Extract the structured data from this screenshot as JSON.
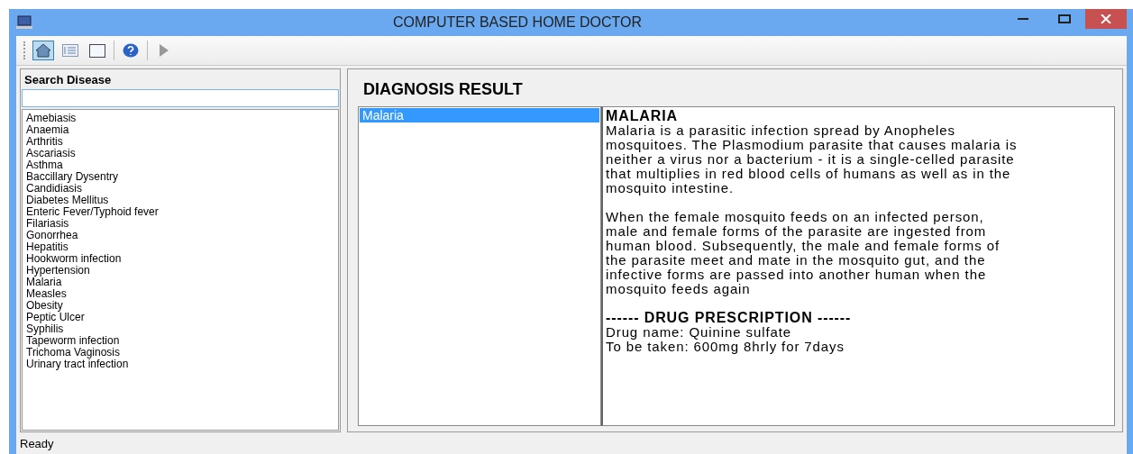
{
  "window": {
    "title": "COMPUTER BASED HOME DOCTOR"
  },
  "toolbar": [
    {
      "kind": "home",
      "selected": true
    },
    {
      "kind": "list",
      "selected": false
    },
    {
      "kind": "blank",
      "selected": false
    },
    {
      "kind": "separator"
    },
    {
      "kind": "help",
      "selected": false
    },
    {
      "kind": "separator"
    },
    {
      "kind": "play",
      "selected": false
    }
  ],
  "search": {
    "title": "Search Disease"
  },
  "diseases": [
    {
      "label": "Amebiasis",
      "selected": false
    },
    {
      "label": "Anaemia",
      "selected": false
    },
    {
      "label": "Arthritis",
      "selected": false
    },
    {
      "label": "Ascariasis",
      "selected": false
    },
    {
      "label": "Asthma",
      "selected": false
    },
    {
      "label": "Baccillary Dysentry",
      "selected": false
    },
    {
      "label": "Candidiasis",
      "selected": false
    },
    {
      "label": "Diabetes Mellitus",
      "selected": false
    },
    {
      "label": "Enteric Fever/Typhoid fever",
      "selected": false
    },
    {
      "label": "Filariasis",
      "selected": false
    },
    {
      "label": "Gonorrhea",
      "selected": false
    },
    {
      "label": "Hepatitis",
      "selected": false
    },
    {
      "label": "Hookworm infection",
      "selected": false
    },
    {
      "label": "Hypertension",
      "selected": false
    },
    {
      "label": "Malaria",
      "selected": false
    },
    {
      "label": "Measles",
      "selected": false
    },
    {
      "label": "Obesity",
      "selected": false
    },
    {
      "label": "Peptic Ulcer",
      "selected": false
    },
    {
      "label": "Syphilis",
      "selected": false
    },
    {
      "label": "Tapeworm infection",
      "selected": false
    },
    {
      "label": "Trichoma Vaginosis",
      "selected": false
    },
    {
      "label": "Urinary tract infection",
      "selected": false
    }
  ],
  "result": {
    "title": "DIAGNOSIS RESULT",
    "matches": [
      {
        "label": "Malaria",
        "selected": true
      }
    ],
    "heading": "MALARIA",
    "paragraphs": [
      "Malaria is a parasitic infection spread by Anopheles mosquitoes. The Plasmodium parasite that causes malaria is neither a virus nor a bacterium - it is a single-celled parasite that multiplies in red blood cells of humans as well as in the mosquito intestine.",
      "When the female mosquito feeds on an infected person, male and female forms of the parasite are ingested from human blood. Subsequently, the male and female forms of the parasite meet and mate in the mosquito gut, and the infective forms are passed into another human when the mosquito feeds again"
    ],
    "prescription_heading": "------ DRUG PRESCRIPTION ------",
    "prescription_lines": [
      "Drug name: Quinine sulfate",
      "To be taken: 600mg 8hrly for 7days"
    ]
  },
  "status_bar": {
    "text": "Ready"
  }
}
